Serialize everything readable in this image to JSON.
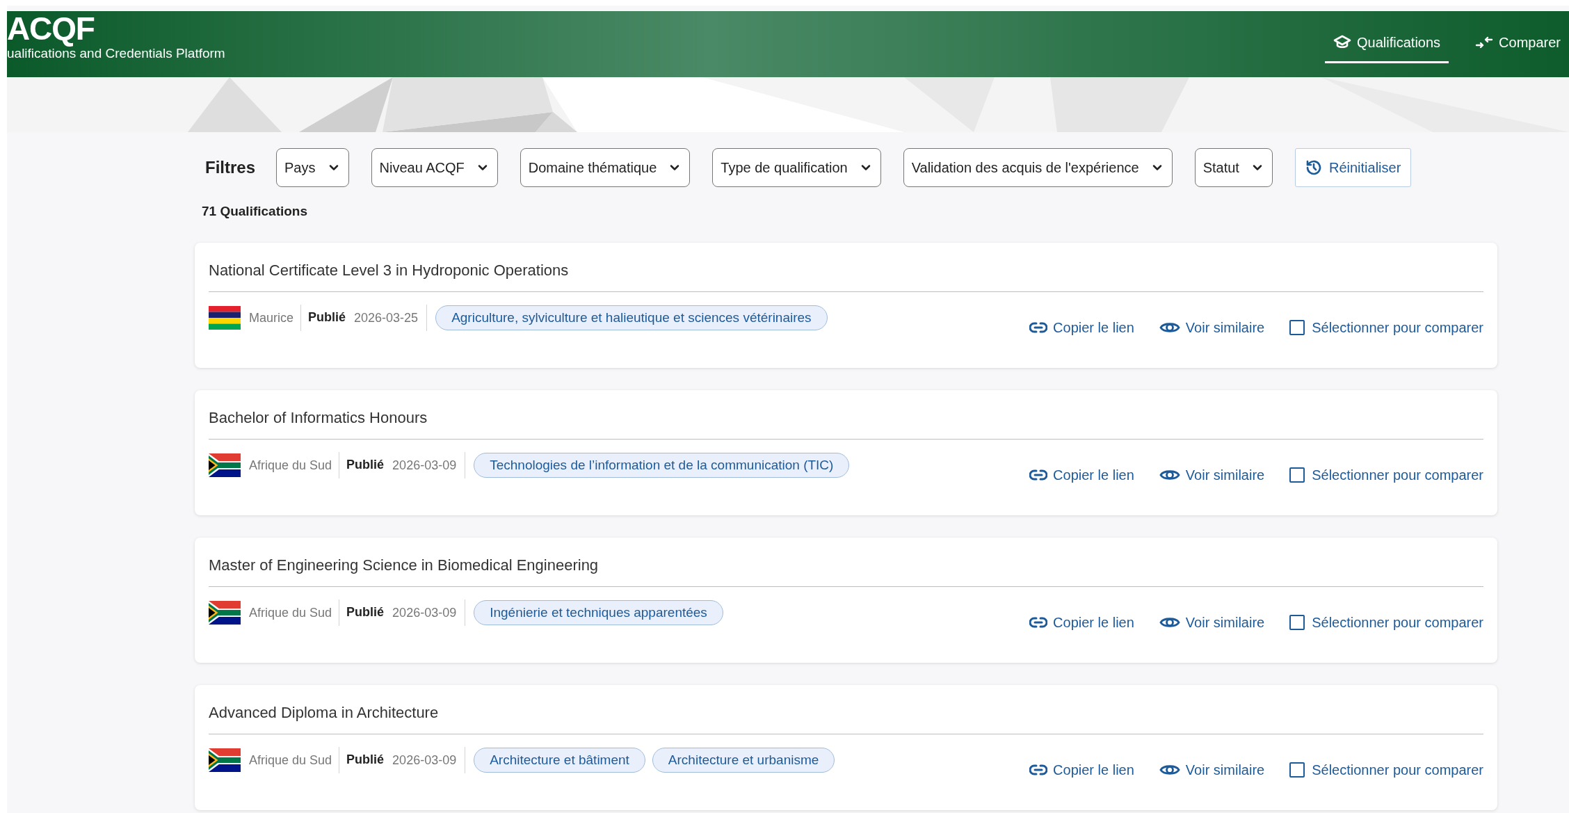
{
  "header": {
    "logo": "ACQF",
    "subtitle": "ualifications and Credentials Platform",
    "nav": [
      {
        "label": "Qualifications",
        "kind": "graduation",
        "selected": true
      },
      {
        "label": "Comparer",
        "kind": "compare",
        "selected": false
      }
    ]
  },
  "filters": {
    "label": "Filtres",
    "selects": [
      "Pays",
      "Niveau ACQF",
      "Domaine thématique",
      "Type de qualification",
      "Validation des acquis de l'expérience",
      "Statut"
    ],
    "reset": "Réinitialiser"
  },
  "count": "71 Qualifications",
  "qualifications": [
    {
      "title": "National Certificate Level 3 in Hydroponic Operations",
      "flag": {
        "kind": "mauritius"
      },
      "country": "Maurice",
      "status": "Publié",
      "date": "2026-03-25",
      "tags": [
        "Agriculture, sylviculture et halieutique et sciences vétérinaires"
      ],
      "copy_link": "Copier le lien",
      "see_similar": "Voir similaire",
      "compare": "Sélectionner pour comparer",
      "checked": false
    },
    {
      "title": "Bachelor of Informatics Honours",
      "flag": {
        "kind": "south_africa"
      },
      "country": "Afrique du Sud",
      "status": "Publié",
      "date": "2026-03-09",
      "tags": [
        "Technologies de l’information et de la communication (TIC)"
      ],
      "copy_link": "Copier le lien",
      "see_similar": "Voir similaire",
      "compare": "Sélectionner pour comparer",
      "checked": false
    },
    {
      "title": "Master of Engineering Science in Biomedical Engineering",
      "flag": {
        "kind": "south_africa"
      },
      "country": "Afrique du Sud",
      "status": "Publié",
      "date": "2026-03-09",
      "tags": [
        "Ingénierie et techniques apparentées"
      ],
      "copy_link": "Copier le lien",
      "see_similar": "Voir similaire",
      "compare": "Sélectionner pour comparer",
      "checked": false
    },
    {
      "title": "Advanced Diploma in Architecture",
      "flag": {
        "kind": "south_africa"
      },
      "country": "Afrique du Sud",
      "status": "Publié",
      "date": "2026-03-09",
      "tags": [
        "Architecture et bâtiment",
        "Architecture et urbanisme"
      ],
      "copy_link": "Copier le lien",
      "see_similar": "Voir similaire",
      "compare": "Sélectionner pour comparer",
      "checked": false
    }
  ]
}
